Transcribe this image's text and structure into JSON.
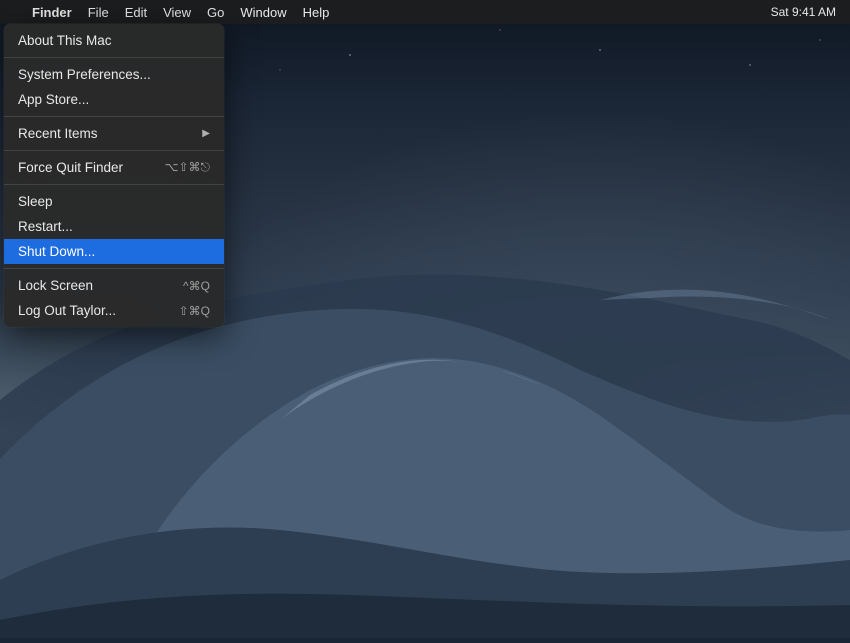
{
  "desktop": {
    "bg_description": "macOS Mojave dark desert dunes wallpaper"
  },
  "menubar": {
    "apple_symbol": "",
    "items": [
      {
        "id": "finder",
        "label": "Finder",
        "bold": true
      },
      {
        "id": "file",
        "label": "File",
        "bold": false
      },
      {
        "id": "edit",
        "label": "Edit",
        "bold": false
      },
      {
        "id": "view",
        "label": "View",
        "bold": false
      },
      {
        "id": "go",
        "label": "Go",
        "bold": false
      },
      {
        "id": "window",
        "label": "Window",
        "bold": false
      },
      {
        "id": "help",
        "label": "Help",
        "bold": false
      }
    ]
  },
  "apple_menu": {
    "items": [
      {
        "id": "about",
        "label": "About This Mac",
        "shortcut": "",
        "type": "item",
        "group": 1
      },
      {
        "id": "divider1",
        "type": "divider"
      },
      {
        "id": "system_prefs",
        "label": "System Preferences...",
        "shortcut": "",
        "type": "item",
        "group": 2
      },
      {
        "id": "app_store",
        "label": "App Store...",
        "shortcut": "",
        "type": "item",
        "group": 2
      },
      {
        "id": "divider2",
        "type": "divider"
      },
      {
        "id": "recent_items",
        "label": "Recent Items",
        "shortcut": "",
        "type": "submenu",
        "group": 3
      },
      {
        "id": "divider3",
        "type": "divider"
      },
      {
        "id": "force_quit",
        "label": "Force Quit Finder",
        "shortcut": "⌥⇧⌘⎋",
        "type": "item",
        "group": 4
      },
      {
        "id": "divider4",
        "type": "divider"
      },
      {
        "id": "sleep",
        "label": "Sleep",
        "shortcut": "",
        "type": "item",
        "group": 5
      },
      {
        "id": "restart",
        "label": "Restart...",
        "shortcut": "",
        "type": "item",
        "group": 5
      },
      {
        "id": "shutdown",
        "label": "Shut Down...",
        "shortcut": "",
        "type": "item",
        "highlighted": true,
        "group": 5
      },
      {
        "id": "divider5",
        "type": "divider"
      },
      {
        "id": "lock_screen",
        "label": "Lock Screen",
        "shortcut": "^⌘Q",
        "type": "item",
        "group": 6
      },
      {
        "id": "logout",
        "label": "Log Out Taylor...",
        "shortcut": "⇧⌘Q",
        "type": "item",
        "group": 6
      }
    ]
  }
}
